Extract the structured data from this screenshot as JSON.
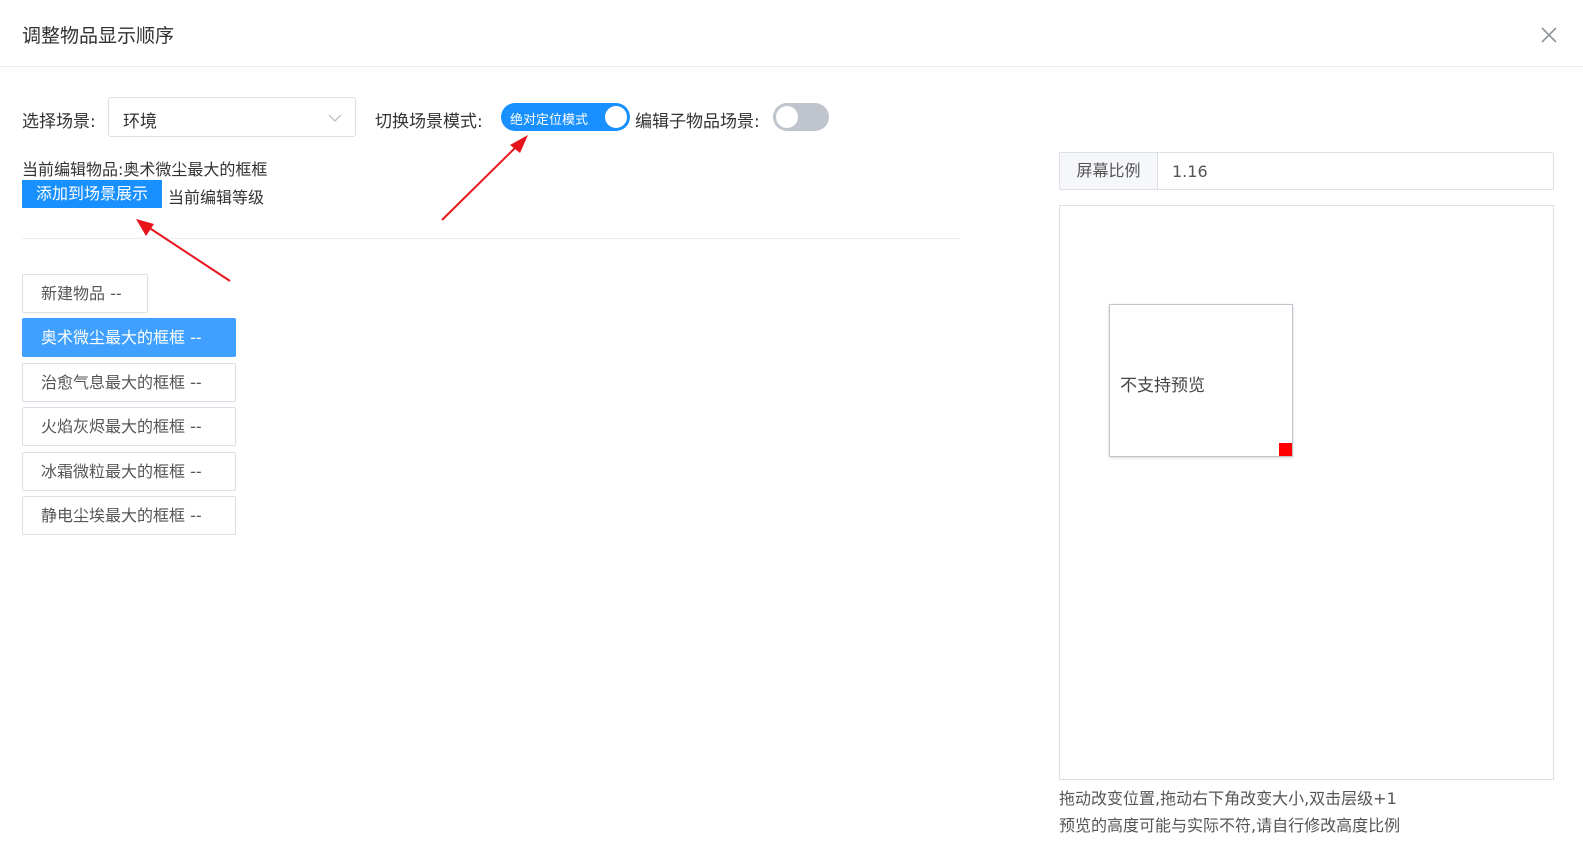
{
  "dialog": {
    "title": "调整物品显示顺序",
    "close_icon": "close-icon"
  },
  "toolbar": {
    "scene_label": "选择场景:",
    "scene_value": "环境",
    "mode_label": "切换场景模式:",
    "mode_switch_text": "绝对定位模式",
    "mode_switch_on": true,
    "child_scene_label": "编辑子物品场景:",
    "child_scene_switch_on": false
  },
  "current": {
    "editing_label": "当前编辑物品:",
    "editing_value": "奥术微尘最大的框框",
    "add_button": "添加到场景展示",
    "level_label": "当前编辑等级"
  },
  "items": [
    {
      "label": "新建物品 --",
      "active": false
    },
    {
      "label": "奥术微尘最大的框框 --",
      "active": true
    },
    {
      "label": "治愈气息最大的框框 --",
      "active": false
    },
    {
      "label": "火焰灰烬最大的框框 --",
      "active": false
    },
    {
      "label": "冰霜微粒最大的框框 --",
      "active": false
    },
    {
      "label": "静电尘埃最大的框框 --",
      "active": false
    }
  ],
  "preview": {
    "ratio_label": "屏幕比例",
    "ratio_value": "1.16",
    "item_text": "不支持预览",
    "hint_line1": "拖动改变位置,拖动右下角改变大小,双击层级+1",
    "hint_line2": "预览的高度可能与实际不符,请自行修改高度比例"
  },
  "colors": {
    "primary": "#1890ff",
    "active_item": "#40a0ff",
    "resize_handle": "#ff0000",
    "annotation_arrow": "#e8141c"
  }
}
